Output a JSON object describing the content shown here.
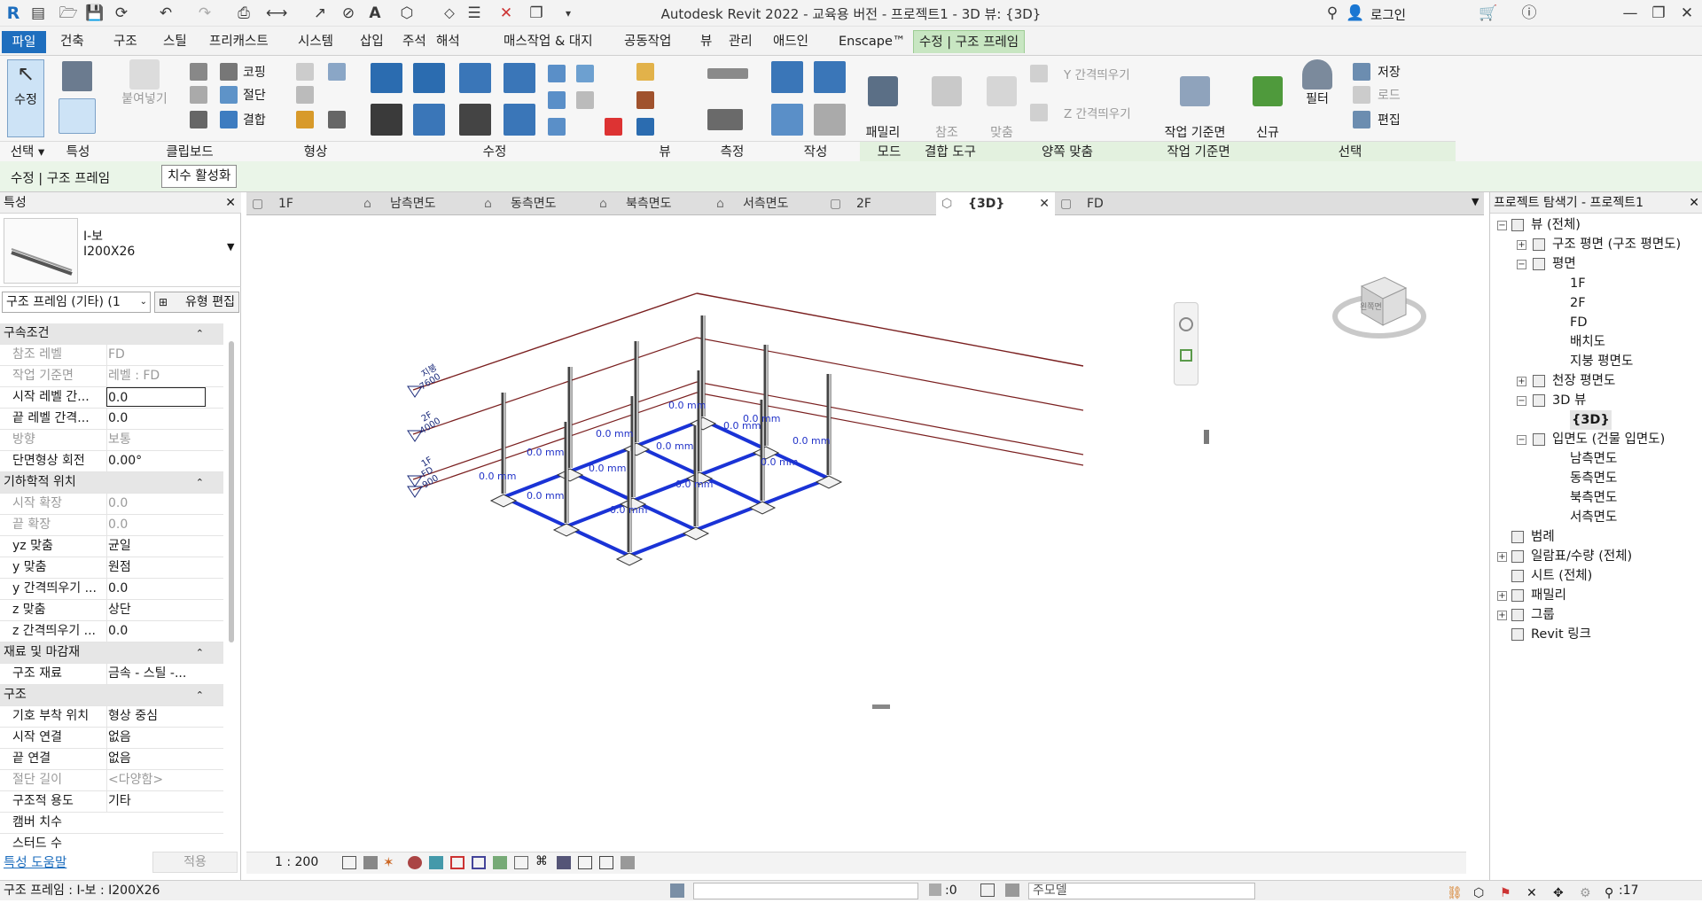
{
  "app": {
    "title": "Autodesk Revit 2022 - 교육용 버전 - 프로젝트1 - 3D 뷰: {3D}",
    "login": "로그인"
  },
  "tabs": [
    "파일",
    "건축",
    "구조",
    "스틸",
    "프리캐스트",
    "시스템",
    "삽입",
    "주석",
    "해석",
    "매스작업 & 대지",
    "공동작업",
    "뷰",
    "관리",
    "애드인",
    "Enscape™",
    "수정 | 구조 프레임"
  ],
  "ribbon": {
    "modify": "수정",
    "paste": "붙여넣기",
    "clip": {
      "cope": "코핑",
      "cut": "절단",
      "join": "결합"
    },
    "family_edit": "패밀리\n편집",
    "ref_change": "참조\n변경",
    "miter": "맞춤\n점",
    "y_offset": "Y 간격띄우기",
    "z_offset": "Z 간격띄우기",
    "wp_edit": "작업 기준면\n편집",
    "new_sel": "신규\n선택",
    "filter": "필터",
    "save": "저장",
    "load": "로드",
    "edit": "편집",
    "groups": [
      "선택 ▾",
      "특성",
      "클립보드",
      "형상",
      "수정",
      "뷰",
      "측정",
      "작성",
      "모드",
      "결합 도구",
      "양쪽 맞춤",
      "작업 기준면",
      "선택"
    ]
  },
  "options": {
    "context": "수정 | 구조 프레임",
    "activate_dims": "치수 활성화"
  },
  "properties": {
    "header": "특성",
    "type_family": "I-보",
    "type_name": "I200X26",
    "selector": "구조 프레임 (기타) (1",
    "edit_type": "유형 편집",
    "rows": [
      {
        "k": "구속조건",
        "sec": true
      },
      {
        "k": "참조 레벨",
        "v": "FD",
        "dis": true
      },
      {
        "k": "작업 기준면",
        "v": "레벨 : FD",
        "dis": true
      },
      {
        "k": "시작 레벨 간...",
        "v": "0.0"
      },
      {
        "k": "끝 레벨 간격...",
        "v": "0.0"
      },
      {
        "k": "방향",
        "v": "보통",
        "dis": true
      },
      {
        "k": "단면형상 회전",
        "v": "0.00°"
      },
      {
        "k": "기하학적 위치",
        "sec": true
      },
      {
        "k": "시작 확장",
        "v": "0.0",
        "dis": true
      },
      {
        "k": "끝 확장",
        "v": "0.0",
        "dis": true
      },
      {
        "k": "yz 맞춤",
        "v": "균일"
      },
      {
        "k": "y 맞춤",
        "v": "원점"
      },
      {
        "k": "y 간격띄우기 ...",
        "v": "0.0"
      },
      {
        "k": "z 맞춤",
        "v": "상단"
      },
      {
        "k": "z 간격띄우기 ...",
        "v": "0.0"
      },
      {
        "k": "재료 및 마감재",
        "sec": true
      },
      {
        "k": "구조 재료",
        "v": "금속 - 스틸 -..."
      },
      {
        "k": "구조",
        "sec": true
      },
      {
        "k": "기호 부착 위치",
        "v": "형상 중심"
      },
      {
        "k": "시작 연결",
        "v": "없음"
      },
      {
        "k": "끝 연결",
        "v": "없음"
      },
      {
        "k": "절단 길이",
        "v": "<다양함>",
        "dis": true
      },
      {
        "k": "구조적 용도",
        "v": "기타"
      },
      {
        "k": "캠버 치수",
        "v": ""
      },
      {
        "k": "스터드 수",
        "v": ""
      }
    ],
    "help": "특성 도움말",
    "apply": "적용"
  },
  "view_tabs": [
    "1F",
    "남측면도",
    "동측면도",
    "북측면도",
    "서측면도",
    "2F",
    "{3D}",
    "FD"
  ],
  "scale": "1 : 200",
  "viewcube_label": "왼쪽면",
  "levels": [
    {
      "name": "지붕",
      "elev": "7600"
    },
    {
      "name": "2F",
      "elev": "4000"
    },
    {
      "name": "1F",
      "elev": ""
    },
    {
      "name": "FD",
      "elev": "-900"
    }
  ],
  "dim_label": "0.0 mm",
  "browser": {
    "title": "프로젝트 탐색기 - 프로젝트1",
    "items": [
      {
        "t": "뷰 (전체)",
        "lvl": 0,
        "tog": "-"
      },
      {
        "t": "구조 평면 (구조 평면도)",
        "lvl": 1,
        "tog": "+"
      },
      {
        "t": "평면",
        "lvl": 1,
        "tog": "-"
      },
      {
        "t": "1F",
        "lvl": 2
      },
      {
        "t": "2F",
        "lvl": 2
      },
      {
        "t": "FD",
        "lvl": 2
      },
      {
        "t": "배치도",
        "lvl": 2
      },
      {
        "t": "지붕 평면도",
        "lvl": 2
      },
      {
        "t": "천장 평면도",
        "lvl": 1,
        "tog": "+"
      },
      {
        "t": "3D 뷰",
        "lvl": 1,
        "tog": "-"
      },
      {
        "t": "{3D}",
        "lvl": 2,
        "sel": true
      },
      {
        "t": "입면도 (건물 입면도)",
        "lvl": 1,
        "tog": "-"
      },
      {
        "t": "남측면도",
        "lvl": 2
      },
      {
        "t": "동측면도",
        "lvl": 2
      },
      {
        "t": "북측면도",
        "lvl": 2
      },
      {
        "t": "서측면도",
        "lvl": 2
      },
      {
        "t": "범례",
        "lvl": 0
      },
      {
        "t": "일람표/수량 (전체)",
        "lvl": 0,
        "tog": "+"
      },
      {
        "t": "시트 (전체)",
        "lvl": 0
      },
      {
        "t": "패밀리",
        "lvl": 0,
        "tog": "+"
      },
      {
        "t": "그룹",
        "lvl": 0,
        "tog": "+"
      },
      {
        "t": "Revit 링크",
        "lvl": 0
      }
    ]
  },
  "status": {
    "text": "구조 프레임 : I-보 : I200X26",
    "zero": ":0",
    "model": "주모델",
    "count": ":17"
  },
  "colors": {
    "accent": "#1e6ebe",
    "beam": "#1a33d6",
    "level": "#7a1f1f",
    "dim": "#2233c8"
  }
}
